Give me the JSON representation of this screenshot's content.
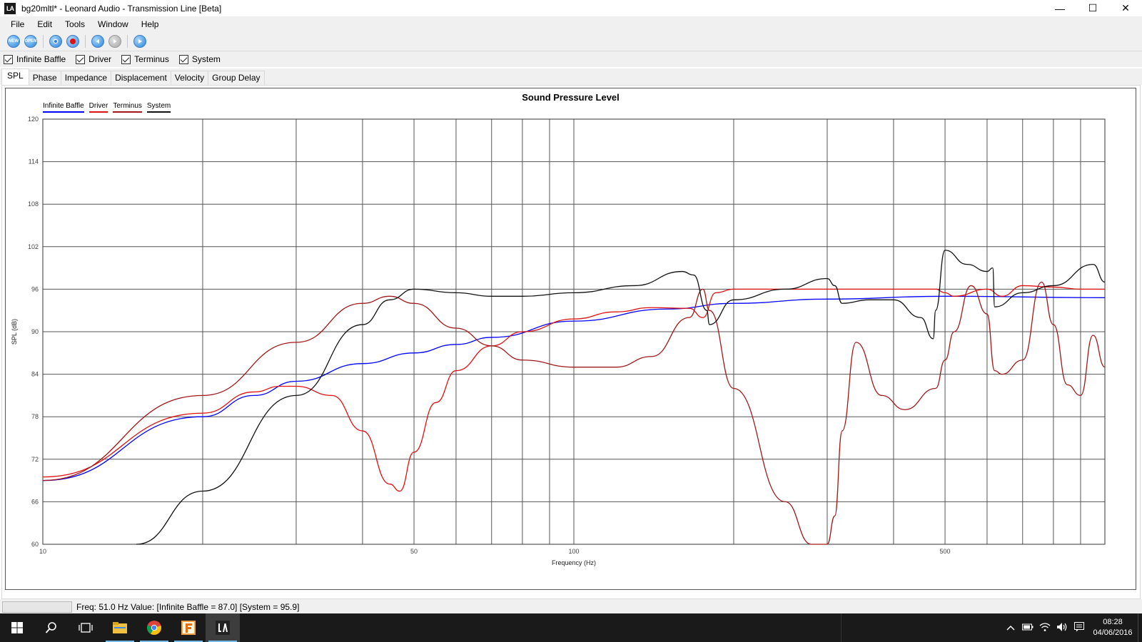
{
  "window": {
    "logo": "LA",
    "title": "bg20mltl* - Leonard Audio - Transmission Line [Beta]",
    "minimize": "—",
    "maximize": "☐",
    "close": "✕"
  },
  "menu": [
    "File",
    "Edit",
    "Tools",
    "Window",
    "Help"
  ],
  "toolbar": {
    "buttons": [
      {
        "name": "new-icon",
        "label": "NEW"
      },
      {
        "name": "open-icon",
        "label": "OPEN"
      },
      {
        "name": "save-icon",
        "label": ""
      },
      {
        "name": "record-icon",
        "label": ""
      },
      {
        "name": "back-icon",
        "label": ""
      },
      {
        "name": "forward-icon",
        "label": ""
      },
      {
        "name": "play-icon",
        "label": ""
      }
    ]
  },
  "checkboxes": [
    {
      "label": "Infinite Baffle",
      "checked": true
    },
    {
      "label": "Driver",
      "checked": true
    },
    {
      "label": "Terminus",
      "checked": true
    },
    {
      "label": "System",
      "checked": true
    }
  ],
  "tabs": [
    {
      "label": "SPL",
      "active": true
    },
    {
      "label": "Phase",
      "active": false
    },
    {
      "label": "Impedance",
      "active": false
    },
    {
      "label": "Displacement",
      "active": false
    },
    {
      "label": "Velocity",
      "active": false
    },
    {
      "label": "Group Delay",
      "active": false
    }
  ],
  "chart_data": {
    "type": "line",
    "title": "Sound Pressure Level",
    "xlabel": "Frequency (Hz)",
    "ylabel": "SPL (dB)",
    "x_scale": "log",
    "xlim": [
      10,
      1000
    ],
    "ylim": [
      60,
      120
    ],
    "x_ticks": [
      10,
      50,
      100,
      500
    ],
    "y_ticks": [
      60,
      66,
      72,
      78,
      84,
      90,
      96,
      102,
      108,
      114,
      120
    ],
    "grid": true,
    "legend_position": "top-left",
    "series": [
      {
        "name": "Infinite Baffle",
        "color": "#0000ff",
        "x": [
          10,
          20,
          25,
          30,
          40,
          50,
          60,
          70,
          100,
          150,
          200,
          300,
          500,
          1000
        ],
        "y": [
          69.0,
          78.0,
          81.0,
          83.0,
          85.5,
          87.0,
          88.2,
          89.2,
          91.5,
          93.2,
          94.0,
          94.6,
          95.0,
          94.8
        ]
      },
      {
        "name": "Driver",
        "color": "#e01010",
        "x": [
          10,
          20,
          25,
          28,
          30,
          35,
          40,
          45,
          47,
          50,
          55,
          60,
          70,
          80,
          100,
          120,
          140,
          165,
          175,
          185,
          200,
          300,
          400,
          480,
          500,
          520,
          600,
          640,
          700,
          800,
          900,
          1000
        ],
        "y": [
          69.5,
          78.5,
          81.5,
          82.3,
          82.3,
          81.0,
          76.0,
          68.5,
          67.5,
          73.0,
          80.0,
          84.5,
          88.0,
          90.0,
          91.8,
          92.8,
          93.4,
          93.3,
          92.0,
          95.5,
          96.0,
          96.0,
          96.0,
          96.0,
          95.5,
          95.0,
          96.0,
          95.0,
          96.5,
          96.3,
          96.0,
          96.0
        ]
      },
      {
        "name": "Terminus",
        "color": "#a01818",
        "x": [
          10,
          20,
          30,
          40,
          45,
          50,
          60,
          70,
          80,
          100,
          120,
          140,
          165,
          175,
          180,
          200,
          250,
          280,
          300,
          310,
          320,
          340,
          380,
          420,
          480,
          500,
          520,
          560,
          600,
          620,
          640,
          700,
          760,
          800,
          850,
          900,
          950,
          1000
        ],
        "y": [
          69.0,
          81.0,
          88.5,
          94.0,
          95.0,
          94.0,
          90.5,
          88.0,
          86.0,
          85.0,
          85.0,
          86.5,
          92.0,
          96.0,
          93.0,
          82.0,
          66.0,
          60.0,
          60.0,
          64.0,
          76.0,
          88.5,
          81.0,
          79.0,
          82.0,
          86.0,
          90.0,
          96.5,
          92.5,
          84.5,
          84.0,
          86.0,
          97.0,
          91.0,
          82.5,
          81.0,
          89.5,
          85.0
        ]
      },
      {
        "name": "System",
        "color": "#111111",
        "x": [
          15,
          20,
          30,
          40,
          45,
          50,
          60,
          70,
          80,
          100,
          130,
          160,
          168,
          178,
          180,
          200,
          250,
          300,
          310,
          320,
          360,
          400,
          450,
          475,
          480,
          500,
          550,
          600,
          615,
          620,
          700,
          800,
          950,
          1000
        ],
        "y": [
          60.0,
          67.5,
          81.0,
          91.0,
          94.5,
          96.0,
          95.5,
          95.0,
          95.0,
          95.5,
          96.5,
          98.5,
          98.0,
          93.0,
          91.0,
          94.5,
          96.0,
          97.5,
          96.5,
          94.0,
          94.5,
          94.5,
          92.0,
          89.0,
          93.0,
          101.5,
          99.5,
          98.5,
          99.0,
          93.5,
          95.5,
          96.5,
          99.5,
          97.0
        ]
      }
    ]
  },
  "status": {
    "text": "Freq: 51.0 Hz   Value: [Infinite Baffle = 87.0]  [System = 95.9]"
  },
  "taskbar": {
    "items": [
      {
        "name": "start-icon"
      },
      {
        "name": "search-icon"
      },
      {
        "name": "task-view-icon"
      },
      {
        "name": "file-explorer-icon"
      },
      {
        "name": "chrome-icon"
      },
      {
        "name": "app-f-icon"
      },
      {
        "name": "leonard-audio-icon"
      }
    ],
    "time": "08:28",
    "date": "04/06/2016"
  }
}
